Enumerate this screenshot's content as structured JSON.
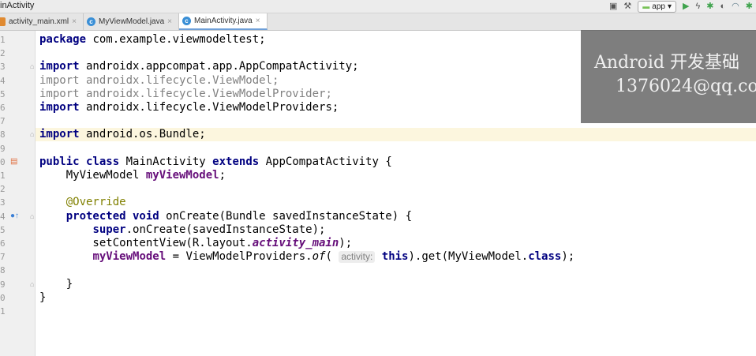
{
  "window": {
    "title": "inActivity"
  },
  "toolbar": {
    "run_config": "app",
    "icons": [
      "layout-icon",
      "build-hammer-icon",
      "run-icon",
      "apply-changes-icon",
      "debug-icon",
      "profile-icon",
      "attach-debugger-icon"
    ]
  },
  "tabs": [
    {
      "label": "activity_main.xml",
      "icon": "xml-file-icon",
      "active": false
    },
    {
      "label": "MyViewModel.java",
      "icon": "class-icon",
      "active": false
    },
    {
      "label": "MainActivity.java",
      "icon": "class-icon",
      "active": true
    }
  ],
  "watermark": {
    "line1": "Android 开发基础",
    "line2": "1376024@qq.com"
  },
  "editor": {
    "line_numbers": [
      "1",
      "2",
      "3",
      "4",
      "5",
      "6",
      "7",
      "8",
      "9",
      "0",
      "1",
      "2",
      "3",
      "4",
      "5",
      "6",
      "7",
      "8",
      "9",
      "0",
      "1"
    ],
    "lines": [
      [
        {
          "t": "package",
          "c": "kw"
        },
        {
          "t": " com.example.viewmodeltest;"
        }
      ],
      [],
      [
        {
          "t": "import",
          "c": "kw"
        },
        {
          "t": " androidx.appcompat.app.AppCompatActivity;"
        }
      ],
      [
        {
          "t": "import",
          "c": "gray"
        },
        {
          "t": " androidx.lifecycle.ViewModel;",
          "c": "gray"
        }
      ],
      [
        {
          "t": "import",
          "c": "gray"
        },
        {
          "t": " androidx.lifecycle.ViewModelProvider;",
          "c": "gray"
        }
      ],
      [
        {
          "t": "import",
          "c": "kw"
        },
        {
          "t": " androidx.lifecycle.ViewModelProviders;"
        }
      ],
      [],
      [
        {
          "t": "import",
          "c": "kw"
        },
        {
          "t": " android.os.Bundle;"
        }
      ],
      [],
      [
        {
          "t": "public class",
          "c": "kw"
        },
        {
          "t": " MainActivity "
        },
        {
          "t": "extends",
          "c": "kw"
        },
        {
          "t": " AppCompatActivity {"
        }
      ],
      [
        {
          "t": "    MyViewModel "
        },
        {
          "t": "myViewModel",
          "c": "field"
        },
        {
          "t": ";"
        }
      ],
      [],
      [
        {
          "t": "    "
        },
        {
          "t": "@Override",
          "c": "ann"
        }
      ],
      [
        {
          "t": "    "
        },
        {
          "t": "protected void",
          "c": "kw"
        },
        {
          "t": " onCreate(Bundle savedInstanceState) {"
        }
      ],
      [
        {
          "t": "        "
        },
        {
          "t": "super",
          "c": "kw"
        },
        {
          "t": ".onCreate(savedInstanceState);"
        }
      ],
      [
        {
          "t": "        setContentView(R.layout."
        },
        {
          "t": "activity_main",
          "c": "italic-field"
        },
        {
          "t": ");"
        }
      ],
      [
        {
          "t": "        "
        },
        {
          "t": "myViewModel",
          "c": "field"
        },
        {
          "t": " = ViewModelProviders."
        },
        {
          "t": "of",
          "c": "italic"
        },
        {
          "t": "( "
        },
        {
          "t": "activity:",
          "c": "hint"
        },
        {
          "t": " "
        },
        {
          "t": "this",
          "c": "kw"
        },
        {
          "t": ").get(MyViewModel."
        },
        {
          "t": "class",
          "c": "kw"
        },
        {
          "t": ");"
        }
      ],
      [],
      [
        {
          "t": "    }"
        }
      ],
      [
        {
          "t": "}"
        }
      ],
      []
    ],
    "caret_line": 8,
    "gutter_marks": [
      {
        "line": 10,
        "name": "activity-layout-icon",
        "glyph": "▤"
      },
      {
        "line": 14,
        "name": "override-method-icon",
        "glyph": "●↑"
      }
    ],
    "fold_lines": [
      3,
      8,
      14,
      19
    ]
  },
  "colors": {
    "keyword": "#000080",
    "field": "#660e7a",
    "annotation": "#808000",
    "unused_import": "#808080",
    "caret_row": "#fcf6de"
  }
}
